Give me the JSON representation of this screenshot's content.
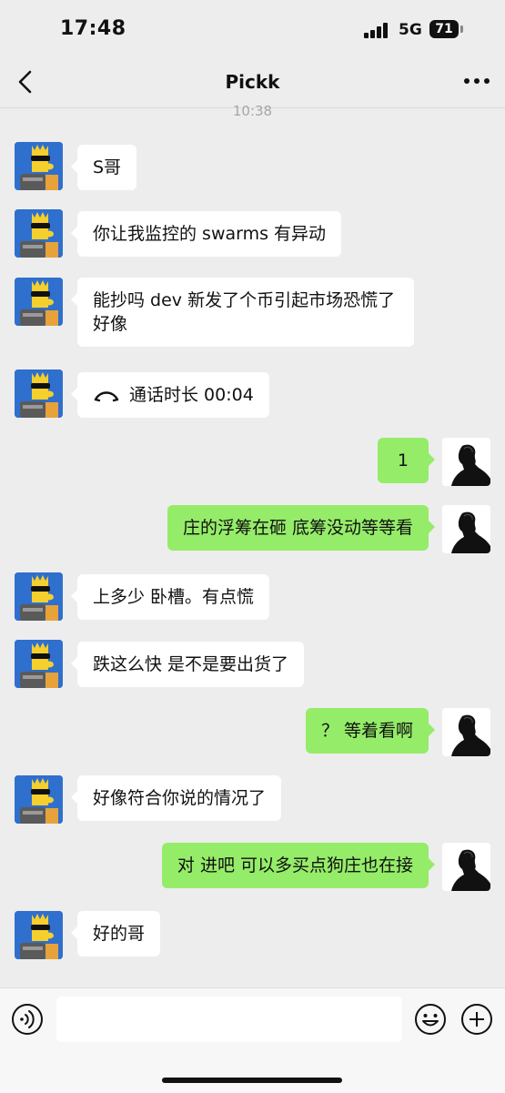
{
  "status_bar": {
    "time": "17:48",
    "network": "5G",
    "battery": "71"
  },
  "header": {
    "title": "Pickk",
    "back_icon": "chevron-left-icon",
    "more_icon": "ellipsis-icon"
  },
  "timestamp": "10:38",
  "messages": [
    {
      "side": "in",
      "text": "S哥"
    },
    {
      "side": "in",
      "text": "你让我监控的 swarms 有异动"
    },
    {
      "side": "in",
      "text": "能抄吗 dev 新发了个币引起市场恐慌了好像"
    },
    {
      "side": "in",
      "type": "call",
      "icon": "phone-hangup-icon",
      "text": "通话时长 00:04"
    },
    {
      "side": "out",
      "text": "1"
    },
    {
      "side": "out",
      "text": "庄的浮筹在砸 底筹没动等等看"
    },
    {
      "side": "in",
      "text": "上多少 卧槽。有点慌"
    },
    {
      "side": "in",
      "text": "跌这么快 是不是要出货了"
    },
    {
      "side": "out",
      "text": "？ 等着看啊"
    },
    {
      "side": "in",
      "text": "好像符合你说的情况了"
    },
    {
      "side": "out",
      "text": "对 进吧 可以多买点狗庄也在接"
    },
    {
      "side": "in",
      "text": "好的哥"
    }
  ],
  "input_bar": {
    "voice_icon": "voice-icon",
    "emoji_icon": "emoji-icon",
    "plus_icon": "plus-icon",
    "input_value": ""
  },
  "colors": {
    "background": "#ededed",
    "incoming_bubble": "#ffffff",
    "outgoing_bubble": "#95ec69"
  }
}
